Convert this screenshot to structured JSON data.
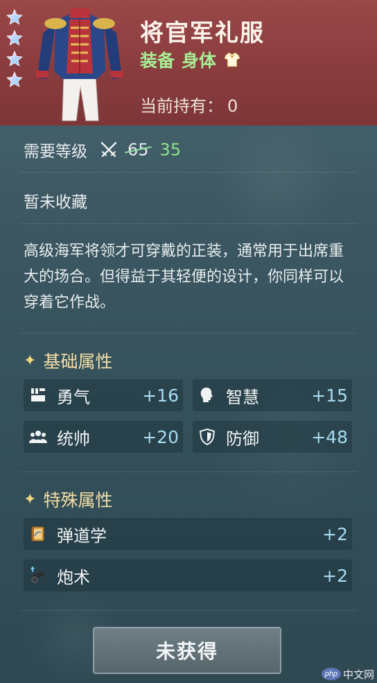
{
  "item": {
    "name": "将官军礼服",
    "category": "装备",
    "slot": "身体",
    "owned_label": "当前持有：",
    "owned_count": "0",
    "stars": 4
  },
  "level": {
    "label": "需要等级",
    "original": "65",
    "reduced": "35"
  },
  "collection_status": "暂未收藏",
  "description": "高级海军将领才可穿戴的正装，通常用于出席重大的场合。但得益于其轻便的设计，你同样可以穿着它作战。",
  "base_attributes": {
    "title": "基础属性",
    "items": [
      {
        "name": "勇气",
        "value": "+16",
        "icon": "courage-icon"
      },
      {
        "name": "智慧",
        "value": "+15",
        "icon": "wisdom-icon"
      },
      {
        "name": "统帅",
        "value": "+20",
        "icon": "command-icon"
      },
      {
        "name": "防御",
        "value": "+48",
        "icon": "defense-shield-icon"
      }
    ]
  },
  "special_attributes": {
    "title": "特殊属性",
    "items": [
      {
        "name": "弹道学",
        "value": "+2",
        "icon": "ballistics-book-icon"
      },
      {
        "name": "炮术",
        "value": "+2",
        "icon": "cannon-icon"
      }
    ]
  },
  "action_button": "未获得",
  "watermark": {
    "logo": "php",
    "text": "中文网"
  },
  "colors": {
    "header_bg": "#8a3c3e",
    "panel_bg": "#3d5862",
    "green_text": "#a8ee95",
    "gold_title": "#f4dfa6",
    "stat_value": "#a8dcf2"
  }
}
